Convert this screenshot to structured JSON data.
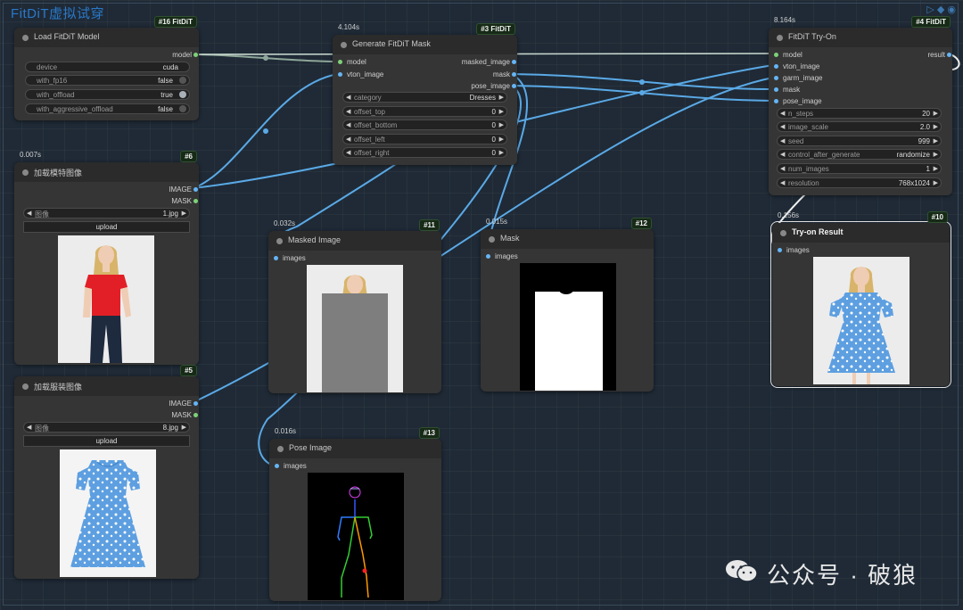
{
  "workflow_title": "FitDiT虚拟试穿",
  "watermark": {
    "text": "公众号 · 破狼",
    "icon": "wechat-icon"
  },
  "colors": {
    "model_pin": "#7dd17a",
    "image_pin": "#64b5f6",
    "link": "#5aa9e6",
    "node_bg": "#353535",
    "title_color": "#2a78c9"
  },
  "nodes": {
    "load_model": {
      "title": "Load FitDiT Model",
      "badge": "#16 FitDiT",
      "outputs": [
        "model"
      ],
      "widgets": [
        {
          "name": "device",
          "value": "cuda"
        },
        {
          "name": "with_fp16",
          "value": "false"
        },
        {
          "name": "with_offload",
          "value": "true"
        },
        {
          "name": "with_aggressive_offload",
          "value": "false"
        }
      ]
    },
    "gen_mask": {
      "title": "Generate FitDiT Mask",
      "badge": "#3 FitDiT",
      "timing": "4.104s",
      "inputs": [
        "model",
        "vton_image"
      ],
      "outputs": [
        "masked_image",
        "mask",
        "pose_image"
      ],
      "widgets": [
        {
          "name": "category",
          "value": "Dresses"
        },
        {
          "name": "offset_top",
          "value": "0"
        },
        {
          "name": "offset_bottom",
          "value": "0"
        },
        {
          "name": "offset_left",
          "value": "0"
        },
        {
          "name": "offset_right",
          "value": "0"
        }
      ]
    },
    "tryon": {
      "title": "FitDiT Try-On",
      "badge": "#4 FitDiT",
      "timing": "8.164s",
      "inputs": [
        "model",
        "vton_image",
        "garm_image",
        "mask",
        "pose_image"
      ],
      "outputs": [
        "result"
      ],
      "widgets": [
        {
          "name": "n_steps",
          "value": "20"
        },
        {
          "name": "image_scale",
          "value": "2.0"
        },
        {
          "name": "seed",
          "value": "999"
        },
        {
          "name": "control_after_generate",
          "value": "randomize"
        },
        {
          "name": "num_images",
          "value": "1"
        },
        {
          "name": "resolution",
          "value": "768x1024"
        }
      ]
    },
    "load_model_image": {
      "title": "加载模特图像",
      "badge": "#6",
      "timing": "0.007s",
      "outputs": [
        "IMAGE",
        "MASK"
      ],
      "widget": {
        "name": "图像",
        "value": "1.jpg"
      },
      "upload_label": "upload"
    },
    "load_garment_image": {
      "title": "加载服装图像",
      "badge": "#5",
      "outputs": [
        "IMAGE",
        "MASK"
      ],
      "widget": {
        "name": "图像",
        "value": "8.jpg"
      },
      "upload_label": "upload"
    },
    "masked_image": {
      "title": "Masked Image",
      "badge": "#11",
      "timing": "0.032s",
      "inputs": [
        "images"
      ]
    },
    "mask_preview": {
      "title": "Mask",
      "badge": "#12",
      "timing": "0.015s",
      "inputs": [
        "images"
      ]
    },
    "pose_image": {
      "title": "Pose Image",
      "badge": "#13",
      "timing": "0.016s",
      "inputs": [
        "images"
      ]
    },
    "result": {
      "title": "Try-on Result",
      "badge": "#10",
      "timing": "0.156s",
      "inputs": [
        "images"
      ]
    }
  }
}
